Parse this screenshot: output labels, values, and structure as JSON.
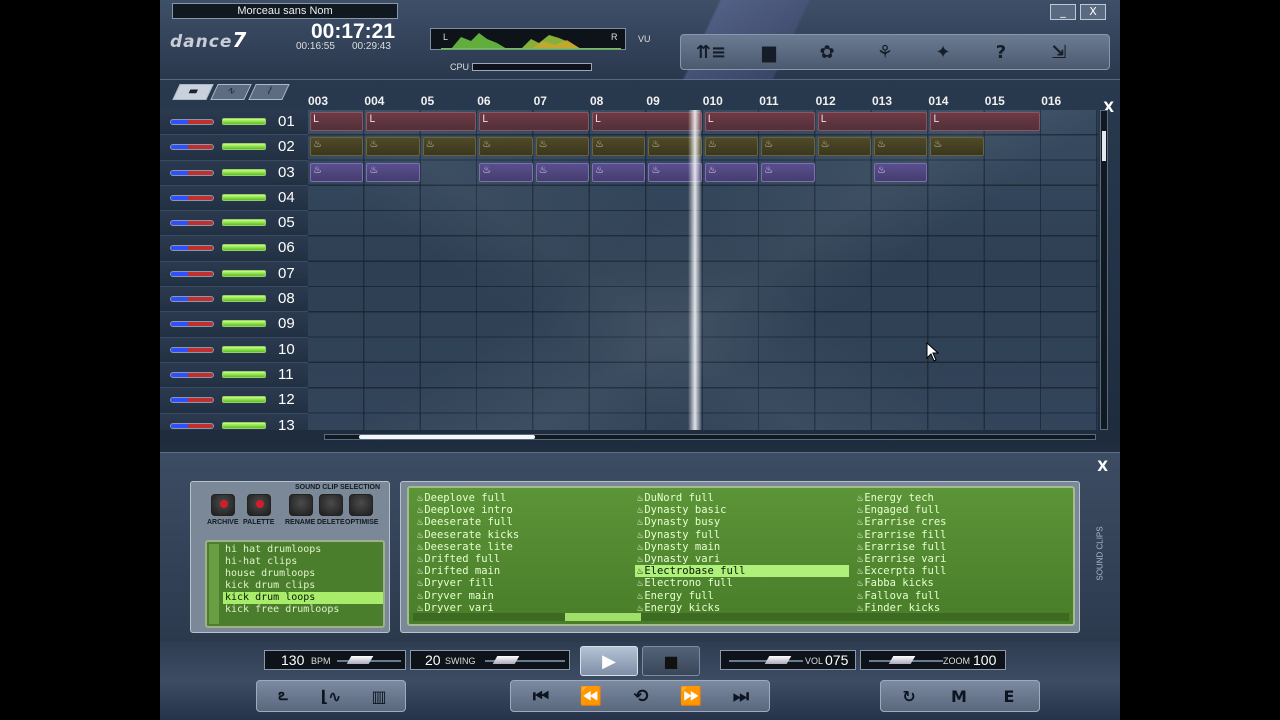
{
  "header": {
    "song_title": "Morceau sans Nom",
    "logo_text": "dance",
    "logo_num": "7",
    "time_main": "00:17:21",
    "time_elapsed": "00:16:55",
    "time_total": "00:29:43",
    "vu_left": "L",
    "vu_right": "R",
    "vu_label": "VU",
    "cpu_label": "CPU"
  },
  "toolbar": {
    "icons": [
      "mixer-icon",
      "folder-icon",
      "effects-icon",
      "samples-icon",
      "settings-icon",
      "help-icon",
      "export-icon"
    ]
  },
  "window": {
    "minimize": "_",
    "close": "X"
  },
  "sequencer": {
    "bars": [
      "003",
      "004",
      "05",
      "06",
      "07",
      "08",
      "09",
      "010",
      "011",
      "012",
      "013",
      "014",
      "015",
      "016"
    ],
    "tracks": [
      "01",
      "02",
      "03",
      "04",
      "05",
      "06",
      "07",
      "08",
      "09",
      "10",
      "11",
      "12",
      "13"
    ],
    "close_label": "X",
    "clips": {
      "t1": [
        [
          0,
          1
        ],
        [
          1,
          2
        ],
        [
          3,
          2
        ],
        [
          5,
          2
        ],
        [
          7,
          2
        ],
        [
          9,
          2
        ],
        [
          11,
          2
        ]
      ],
      "t2": [
        [
          0,
          1
        ],
        [
          1,
          1
        ],
        [
          2,
          1
        ],
        [
          3,
          1
        ],
        [
          4,
          1
        ],
        [
          5,
          1
        ],
        [
          6,
          1
        ],
        [
          7,
          1
        ],
        [
          8,
          1
        ],
        [
          9,
          1
        ],
        [
          10,
          1
        ],
        [
          11,
          1
        ]
      ],
      "t3": [
        [
          0,
          1
        ],
        [
          1,
          1
        ],
        [
          3,
          1
        ],
        [
          4,
          1
        ],
        [
          5,
          1
        ],
        [
          6,
          1
        ],
        [
          7,
          1
        ],
        [
          8,
          1
        ],
        [
          10,
          1
        ]
      ]
    }
  },
  "selection": {
    "title": "SOUND CLIP SELECTION",
    "buttons": [
      "ARCHIVE",
      "PALETTE",
      "RENAME",
      "DELETE",
      "OPTIMISE"
    ],
    "categories": [
      "hi hat drumloops",
      "hi-hat clips",
      "house drumloops",
      "kick drum clips",
      "kick drum loops",
      "kick free drumloops"
    ],
    "selected_category": "kick drum loops"
  },
  "clips": {
    "columns": [
      [
        "Deeplove full",
        "Deeplove intro",
        "Deeserate full",
        "Deeserate kicks",
        "Deeserate lite",
        "Drifted full",
        "Drifted main",
        "Dryver fill",
        "Dryver main",
        "Dryver vari"
      ],
      [
        "DuNord full",
        "Dynasty basic",
        "Dynasty busy",
        "Dynasty full",
        "Dynasty main",
        "Dynasty vari",
        "Electrobase full",
        "Electrono full",
        "Energy full",
        "Energy kicks"
      ],
      [
        "Energy tech",
        "Engaged full",
        "Erarrise cres",
        "Erarrise fill",
        "Erarrise full",
        "Erarrise vari",
        "Excerpta full",
        "Fabba kicks",
        "Fallova full",
        "Finder kicks"
      ]
    ],
    "selected": "Electrobase full",
    "side_label": "SOUND CLIPS",
    "close_label": "X"
  },
  "transport": {
    "bpm_value": "130",
    "bpm_unit": "BPM",
    "swing_value": "20",
    "swing_unit": "SWING",
    "vol_unit": "VOL",
    "vol_value": "075",
    "zoom_unit": "ZOOM",
    "zoom_value": "100",
    "play": "▶",
    "stop": "■",
    "nav": [
      "⏮",
      "⏪",
      "⟲",
      "⏩",
      "⏭"
    ],
    "view_icons": [
      "wave-icon",
      "curve-icon",
      "grid-icon"
    ],
    "fx_icons": [
      "loop-icon",
      "mixdown-icon",
      "edit-icon"
    ]
  }
}
